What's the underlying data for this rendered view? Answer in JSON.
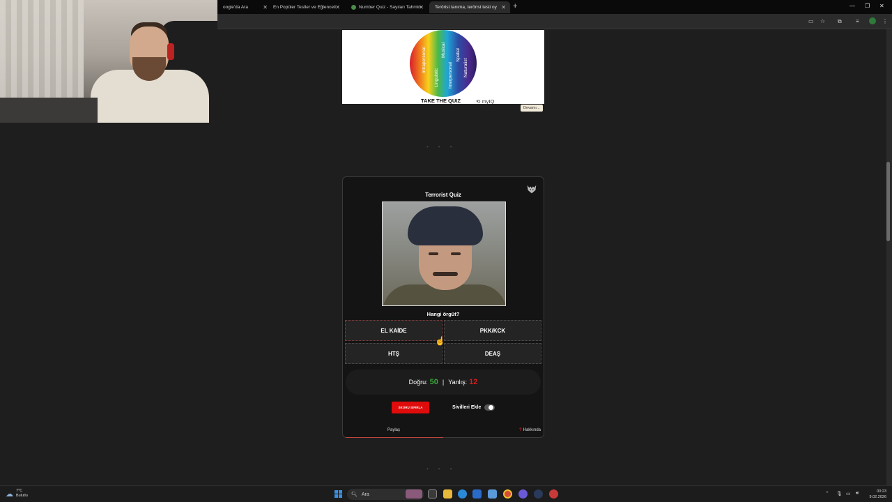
{
  "browser": {
    "tabs": [
      {
        "label": "oogle'da Ara",
        "active": false
      },
      {
        "label": "En Popüler Testler ve Eğlenceli",
        "active": false
      },
      {
        "label": "Number Quiz - Sayıları Tahmin",
        "active": false
      },
      {
        "label": "Terörist tanıma, terörist testi oy",
        "active": true
      }
    ],
    "new_tab_icon": "plus-icon"
  },
  "ad": {
    "wheel_labels": [
      "Intrapersonal",
      "Linguistic",
      "Musical",
      "Interpersonal",
      "Spatial",
      "Naturalist"
    ],
    "cta": "TAKE THE QUIZ",
    "brand": "myIQ",
    "more_label": "Devamı..."
  },
  "quiz": {
    "title": "Terrorist Quiz",
    "question": "Hangi örgüt?",
    "answers": [
      "EL KAİDE",
      "PKK/KCK",
      "HTŞ",
      "DEAŞ"
    ],
    "score": {
      "correct_label": "Doğru:",
      "correct_value": "50",
      "separator": "|",
      "wrong_label": "Yanlış:",
      "wrong_value": "12"
    },
    "reset_label": "SKORU SIFIRLA",
    "toggle_label": "Sivilleri Ekle",
    "toggle_on": false,
    "share_label": "Paylaş",
    "about_label": "Hakkında"
  },
  "taskbar": {
    "weather_temp": "7°C",
    "weather_desc": "Bulutlu",
    "search_placeholder": "Ara",
    "time": "00:23",
    "date": "9.02.2026"
  },
  "colors": {
    "accent_red": "#e00b0b",
    "correct_green": "#3aa83a",
    "wrong_red": "#d42020",
    "page_bg": "#1e1e1e",
    "card_bg": "#141414"
  }
}
